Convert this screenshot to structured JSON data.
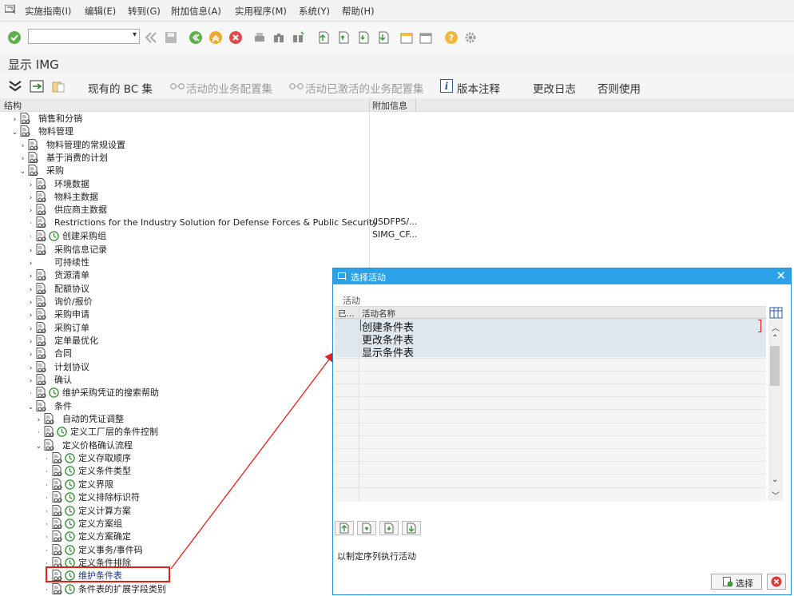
{
  "menu": [
    "实施指南(I)",
    "编辑(E)",
    "转到(G)",
    "附加信息(A)",
    "实用程序(M)",
    "系统(Y)",
    "帮助(H)"
  ],
  "title": "显示 IMG",
  "app_toolbar": {
    "bc_sets": "现有的 BC 集",
    "active_bc": "活动的业务配置集",
    "activated_bc": "活动已激活的业务配置集",
    "release_notes": "版本注释",
    "change_log": "更改日志",
    "usage": "否则使用"
  },
  "tree_header": {
    "structure": "结构",
    "info": "附加信息"
  },
  "tree": [
    {
      "label": "销售和分销",
      "exp": "›",
      "lvl": 0,
      "clock": false
    },
    {
      "label": "物料管理",
      "exp": "⌄",
      "lvl": 0,
      "clock": false
    },
    {
      "label": "物料管理的常规设置",
      "exp": "›",
      "lvl": 1,
      "clock": false
    },
    {
      "label": "基于消费的计划",
      "exp": "›",
      "lvl": 1,
      "clock": false
    },
    {
      "label": "采购",
      "exp": "⌄",
      "lvl": 1,
      "clock": false
    },
    {
      "label": "环境数据",
      "exp": "›",
      "lvl": 2,
      "clock": false
    },
    {
      "label": "物料主数据",
      "exp": "›",
      "lvl": 2,
      "clock": false
    },
    {
      "label": "供应商主数据",
      "exp": "›",
      "lvl": 2,
      "clock": false
    },
    {
      "label": "Restrictions for the Industry Solution for Defense Forces & Public Security",
      "exp": "·",
      "lvl": 2,
      "clock": false,
      "info": "/ISDFPS/..."
    },
    {
      "label": "创建采购组",
      "exp": "·",
      "lvl": 2,
      "clock": true,
      "info": "SIMG_CF..."
    },
    {
      "label": "采购信息记录",
      "exp": "›",
      "lvl": 2,
      "clock": false
    },
    {
      "label": "可持续性",
      "exp": "›",
      "lvl": 2,
      "clock": false,
      "nodoc": true
    },
    {
      "label": "货源清单",
      "exp": "›",
      "lvl": 2,
      "clock": false
    },
    {
      "label": "配额协议",
      "exp": "›",
      "lvl": 2,
      "clock": false
    },
    {
      "label": "询价/报价",
      "exp": "›",
      "lvl": 2,
      "clock": false
    },
    {
      "label": "采购申请",
      "exp": "›",
      "lvl": 2,
      "clock": false
    },
    {
      "label": "采购订单",
      "exp": "›",
      "lvl": 2,
      "clock": false
    },
    {
      "label": "定单最优化",
      "exp": "›",
      "lvl": 2,
      "clock": false
    },
    {
      "label": "合同",
      "exp": "›",
      "lvl": 2,
      "clock": false
    },
    {
      "label": "计划协议",
      "exp": "›",
      "lvl": 2,
      "clock": false
    },
    {
      "label": "确认",
      "exp": "›",
      "lvl": 2,
      "clock": false
    },
    {
      "label": "维护采购凭证的搜索帮助",
      "exp": "·",
      "lvl": 2,
      "clock": true
    },
    {
      "label": "条件",
      "exp": "⌄",
      "lvl": 2,
      "clock": false
    },
    {
      "label": "自动的凭证调整",
      "exp": "›",
      "lvl": 3,
      "clock": false
    },
    {
      "label": "定义工厂层的条件控制",
      "exp": "·",
      "lvl": 3,
      "clock": true
    },
    {
      "label": "定义价格确认流程",
      "exp": "⌄",
      "lvl": 3,
      "clock": false
    },
    {
      "label": "定义存取顺序",
      "exp": "·",
      "lvl": 4,
      "clock": true
    },
    {
      "label": "定义条件类型",
      "exp": "·",
      "lvl": 4,
      "clock": true
    },
    {
      "label": "定义界限",
      "exp": "·",
      "lvl": 4,
      "clock": true
    },
    {
      "label": "定义排除标识符",
      "exp": "·",
      "lvl": 4,
      "clock": true
    },
    {
      "label": "定义计算方案",
      "exp": "·",
      "lvl": 4,
      "clock": true
    },
    {
      "label": "定义方案组",
      "exp": "·",
      "lvl": 4,
      "clock": true
    },
    {
      "label": "定义方案确定",
      "exp": "·",
      "lvl": 4,
      "clock": true
    },
    {
      "label": "定义事务/事件码",
      "exp": "·",
      "lvl": 4,
      "clock": true
    },
    {
      "label": "定义条件排除",
      "exp": "·",
      "lvl": 4,
      "clock": true
    },
    {
      "label": "维护条件表",
      "exp": "·",
      "lvl": 4,
      "clock": true,
      "highlight": true
    },
    {
      "label": "条件表的扩展字段类别",
      "exp": "·",
      "lvl": 4,
      "clock": true
    }
  ],
  "dialog": {
    "title": "选择活动",
    "section": "活动",
    "col_done": "已...",
    "col_name": "活动名称",
    "rows": [
      "创建条件表",
      "更改条件表",
      "显示条件表"
    ],
    "hint": "以制定序列执行活动",
    "ok_label": "选择"
  }
}
